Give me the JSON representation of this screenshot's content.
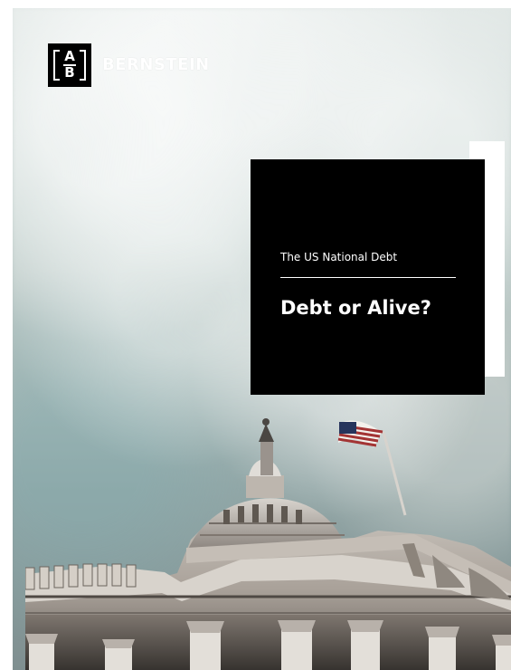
{
  "brand": {
    "logo_top": "A",
    "logo_bottom": "B",
    "name": "BERNSTEIN"
  },
  "title_block": {
    "kicker": "The US National Debt",
    "headline": "Debt or Alive?"
  },
  "colors": {
    "sky": "#c7d4d1",
    "title_box": "#000000",
    "title_text": "#ffffff",
    "building": "#b7b0a8",
    "building_shadow": "#544d47",
    "flag_red": "#a33434",
    "flag_blue": "#27345c"
  },
  "image": {
    "subject": "capitol-building-with-flag"
  }
}
